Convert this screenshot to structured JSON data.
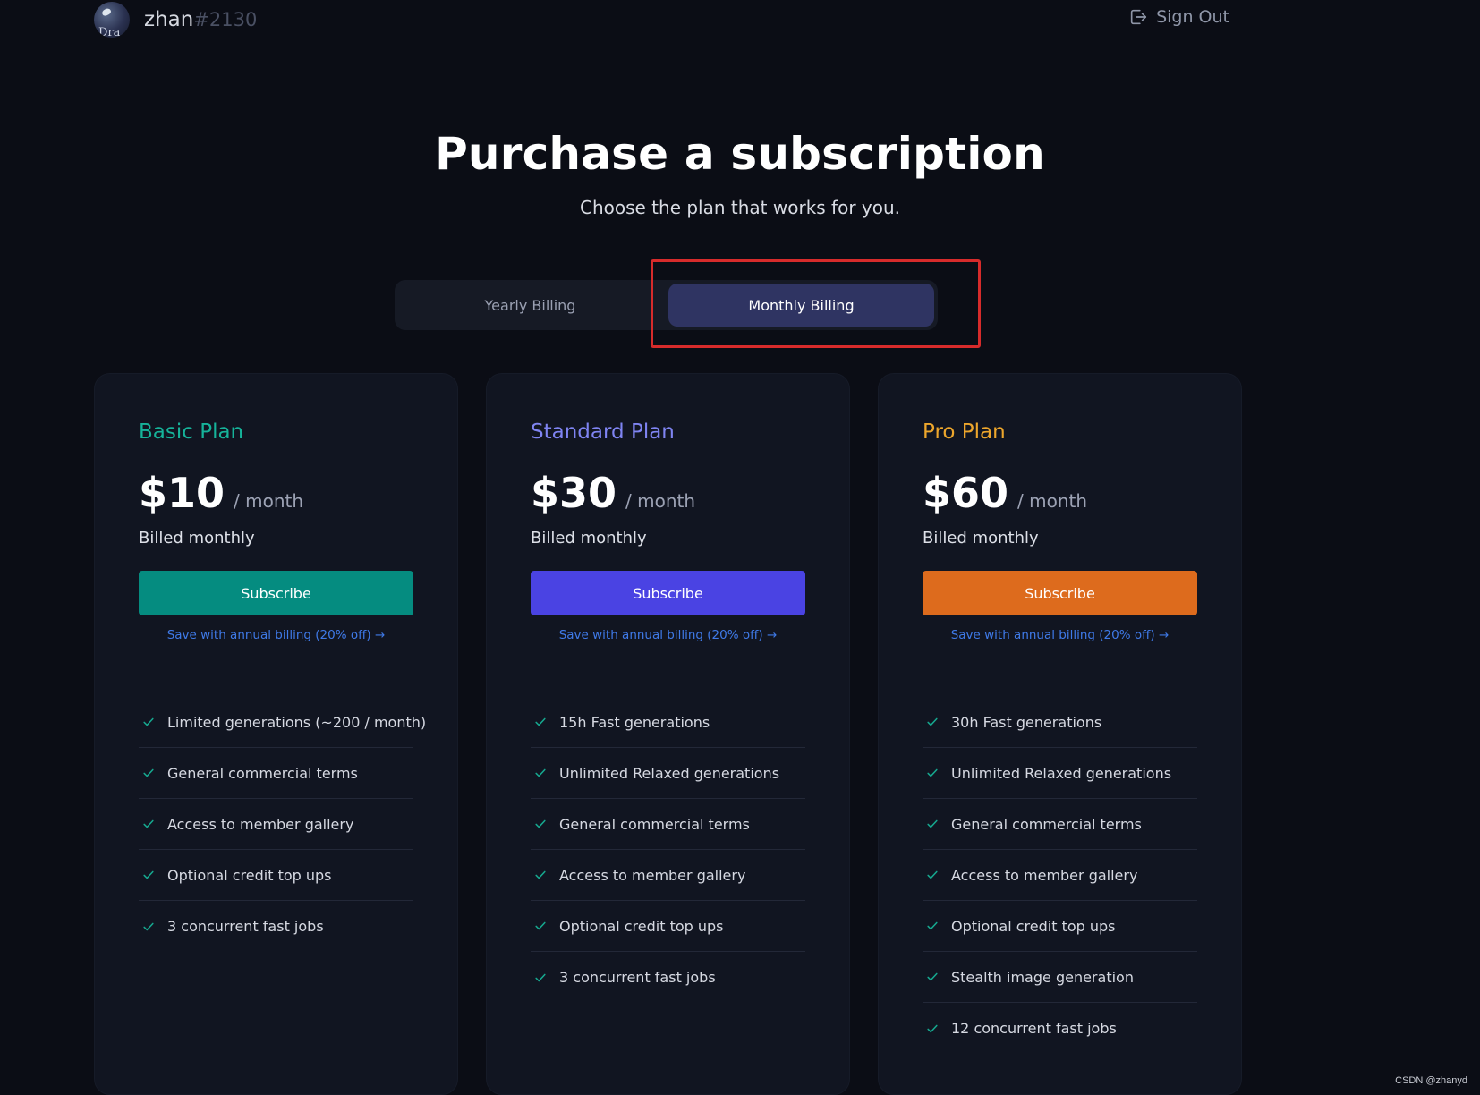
{
  "header": {
    "username": "zhan",
    "usertag": "#2130",
    "avatar_text": "Dra",
    "sign_out_label": "Sign Out"
  },
  "title": "Purchase a subscription",
  "subtitle": "Choose the plan that works for you.",
  "billing_toggle": {
    "yearly_label": "Yearly Billing",
    "monthly_label": "Monthly Billing",
    "selected": "monthly"
  },
  "plans": [
    {
      "name": "Basic Plan",
      "price": "$10",
      "period": "/ month",
      "billed": "Billed monthly",
      "subscribe_label": "Subscribe",
      "save_link": "Save with annual billing (20% off) →",
      "accent": "#16b39a",
      "button_color": "#058c80",
      "features": [
        "Limited generations (~200 / month)",
        "General commercial terms",
        "Access to member gallery",
        "Optional credit top ups",
        "3 concurrent fast jobs"
      ]
    },
    {
      "name": "Standard Plan",
      "price": "$30",
      "period": "/ month",
      "billed": "Billed monthly",
      "subscribe_label": "Subscribe",
      "save_link": "Save with annual billing (20% off) →",
      "accent": "#7f84f2",
      "button_color": "#4a43e3",
      "features": [
        "15h Fast generations",
        "Unlimited Relaxed generations",
        "General commercial terms",
        "Access to member gallery",
        "Optional credit top ups",
        "3 concurrent fast jobs"
      ]
    },
    {
      "name": "Pro Plan",
      "price": "$60",
      "period": "/ month",
      "billed": "Billed monthly",
      "subscribe_label": "Subscribe",
      "save_link": "Save with annual billing (20% off) →",
      "accent": "#eda62c",
      "button_color": "#dd6b1d",
      "features": [
        "30h Fast generations",
        "Unlimited Relaxed generations",
        "General commercial terms",
        "Access to member gallery",
        "Optional credit top ups",
        "Stealth image generation",
        "12 concurrent fast jobs"
      ]
    }
  ],
  "icons": {
    "check": "check-icon",
    "sign_out": "sign-out-icon"
  },
  "highlight_color": "#d72b2b",
  "watermark": "CSDN @zhanyd"
}
